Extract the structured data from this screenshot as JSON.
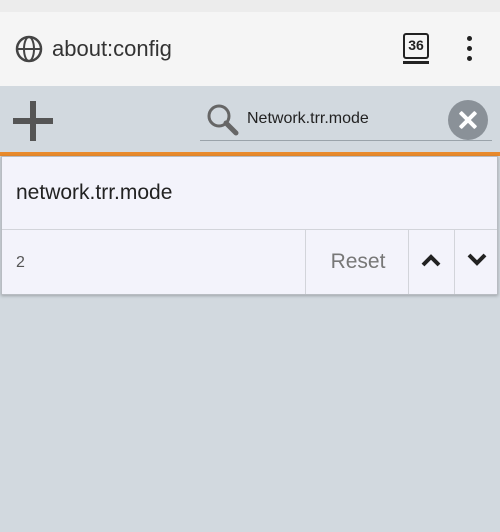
{
  "toolbar": {
    "url": "about:config",
    "tab_count": "36"
  },
  "search": {
    "query": "Network.trr.mode"
  },
  "preference": {
    "name": "network.trr.mode",
    "value": "2",
    "reset_label": "Reset"
  },
  "colors": {
    "accent": "#e98a2c",
    "background": "#d2d9df",
    "card": "#f3f3fb"
  },
  "icons": [
    "globe-icon",
    "menu-icon",
    "add-icon",
    "search-icon",
    "clear-icon",
    "chevron-up-icon",
    "chevron-down-icon"
  ]
}
